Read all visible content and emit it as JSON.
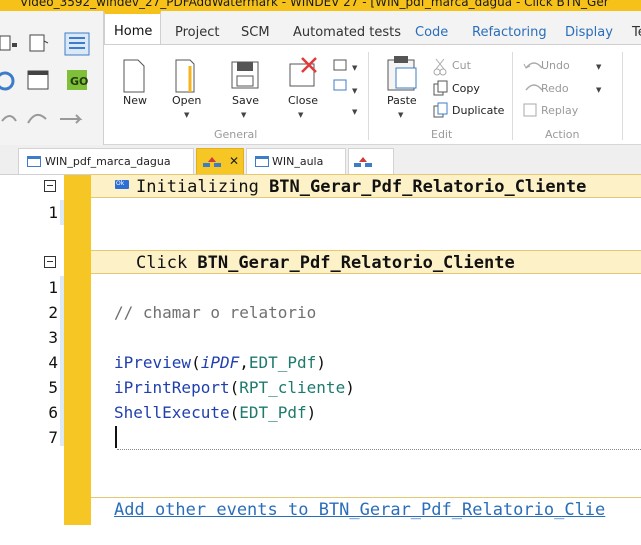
{
  "window": {
    "title": "Video_3592_windev_27_PDFAddWatermark - WINDEV 27 - [WIN_pdf_marca_dagua - Click BTN_Ger"
  },
  "ribbon": {
    "tabs": [
      "Home",
      "Project",
      "SCM",
      "Automated tests",
      "Code",
      "Refactoring",
      "Display",
      "Te"
    ],
    "active_tab": "Home",
    "general": {
      "label": "General",
      "new": "New",
      "open": "Open",
      "save": "Save",
      "close": "Close"
    },
    "edit": {
      "label": "Edit",
      "paste": "Paste",
      "cut": "Cut",
      "copy": "Copy",
      "duplicate": "Duplicate"
    },
    "action": {
      "label": "Action",
      "undo": "Undo",
      "redo": "Redo",
      "replay": "Replay"
    },
    "go_label": "GO"
  },
  "doc_tabs": [
    {
      "label": "WIN_pdf_marca_dagua",
      "active": false
    },
    {
      "label": "",
      "active": true
    },
    {
      "label": "WIN_aula",
      "active": false
    },
    {
      "label": "",
      "active": false
    }
  ],
  "editor": {
    "event1_prefix": "Initializing ",
    "event1_name": "BTN_Gerar_Pdf_Relatorio_Cliente",
    "event1_lines": [
      "1"
    ],
    "event2_prefix": "Click ",
    "event2_name": "BTN_Gerar_Pdf_Relatorio_Cliente",
    "line_numbers": [
      "1",
      "2",
      "3",
      "4",
      "5",
      "6",
      "7"
    ],
    "comment": "// chamar o relatorio",
    "l4_fn": "iPreview",
    "l4_open": "(",
    "l4_arg1": "iPDF",
    "l4_comma": ",",
    "l4_arg2": "EDT_Pdf",
    "l4_close": ")",
    "l5_fn": "iPrintReport",
    "l5_open": "(",
    "l5_arg": "RPT_cliente",
    "l5_close": ")",
    "l6_fn": "ShellExecute",
    "l6_open": "(",
    "l6_arg": "EDT_Pdf",
    "l6_close": ")",
    "ok_badge": "Ok",
    "add_events": "Add other events to BTN_Gerar_Pdf_Relatorio_Clie"
  }
}
